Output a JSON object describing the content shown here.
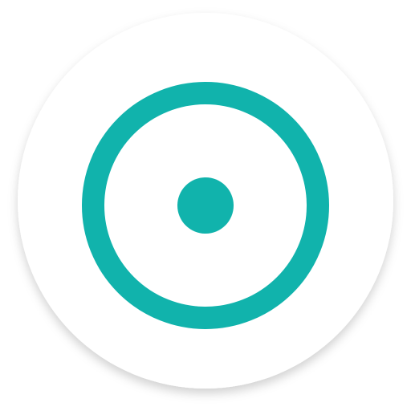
{
  "app_icon": {
    "name": "target-ring-dot",
    "colors": {
      "background": "#ffffff",
      "badge": "#ffffff",
      "badge_shadow": "#000000",
      "ring": "#11b3ac",
      "dot": "#11b3ac"
    }
  }
}
